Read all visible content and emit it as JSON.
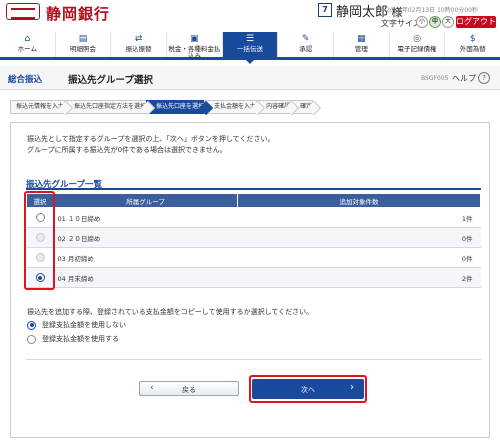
{
  "header": {
    "bank_name": "静岡銀行",
    "user_badge": "7",
    "user_name": "静岡太郎",
    "user_suffix": "様",
    "last_login": "20XX年02月13日 10時00分00秒",
    "text_size_label": "文字サイズ",
    "text_sizes": [
      "小",
      "中",
      "大"
    ],
    "active_text_size": "中",
    "logout": "ログアウト"
  },
  "nav": [
    {
      "label": "ホーム",
      "icon": "home-icon",
      "glyph": "⌂",
      "active": false
    },
    {
      "label": "明細照会",
      "icon": "document-icon",
      "glyph": "▤",
      "active": false
    },
    {
      "label": "振込振替",
      "icon": "transfer-icon",
      "glyph": "⇄",
      "active": false
    },
    {
      "label": "税金・各種料金払込み",
      "icon": "payment-icon",
      "glyph": "▣",
      "active": false
    },
    {
      "label": "一括伝送",
      "icon": "bulk-transfer-icon",
      "glyph": "☰",
      "active": true
    },
    {
      "label": "承認",
      "icon": "approval-icon",
      "glyph": "✎",
      "active": false
    },
    {
      "label": "管理",
      "icon": "management-icon",
      "glyph": "▦",
      "active": false
    },
    {
      "label": "電子記録債権",
      "icon": "e-receivable-icon",
      "glyph": "◎",
      "active": false
    },
    {
      "label": "外国為替",
      "icon": "foreign-exchange-icon",
      "glyph": "$",
      "active": false
    }
  ],
  "title_bar": {
    "section": "総合振込",
    "title": "振込先グループ選択",
    "screen_id": "BSGF005",
    "help": "ヘルプ",
    "help_icon": "?"
  },
  "steps": [
    {
      "label": "振込元情報を入力",
      "active": false
    },
    {
      "label": "振込先口座指定方法を選択",
      "active": false
    },
    {
      "label": "振込先口座を選択",
      "active": true
    },
    {
      "label": "支払金額を入力",
      "active": false
    },
    {
      "label": "内容確認",
      "active": false
    },
    {
      "label": "確定",
      "active": false
    }
  ],
  "intro": {
    "line1": "振込先として指定するグループを選択の上、「次へ」ボタンを押してください。",
    "line2": "グループに所属する振込先が0件である場合は選択できません。"
  },
  "group_list": {
    "title": "振込先グループ一覧",
    "columns": {
      "select": "選択",
      "group": "所属グループ",
      "count": "追加対象件数"
    },
    "rows": [
      {
        "name": "01 １０日締め",
        "count": "1件",
        "state": "enabled"
      },
      {
        "name": "02 ２０日締め",
        "count": "0件",
        "state": "disabled"
      },
      {
        "name": "03 月初締め",
        "count": "0件",
        "state": "disabled"
      },
      {
        "name": "04 月末締め",
        "count": "2件",
        "state": "checked"
      }
    ]
  },
  "copy_option": {
    "note": "振込先を追加する際、登録されている支払金額をコピーして使用するか選択してください。",
    "options": [
      {
        "label": "登録支払金額を使用しない",
        "checked": true
      },
      {
        "label": "登録支払金額を使用する",
        "checked": false
      }
    ]
  },
  "buttons": {
    "back": "戻る",
    "next": "次へ"
  },
  "colors": {
    "brand_red": "#b0101e",
    "nav_blue": "#1a4a9c",
    "highlight_red": "#e0141e"
  }
}
